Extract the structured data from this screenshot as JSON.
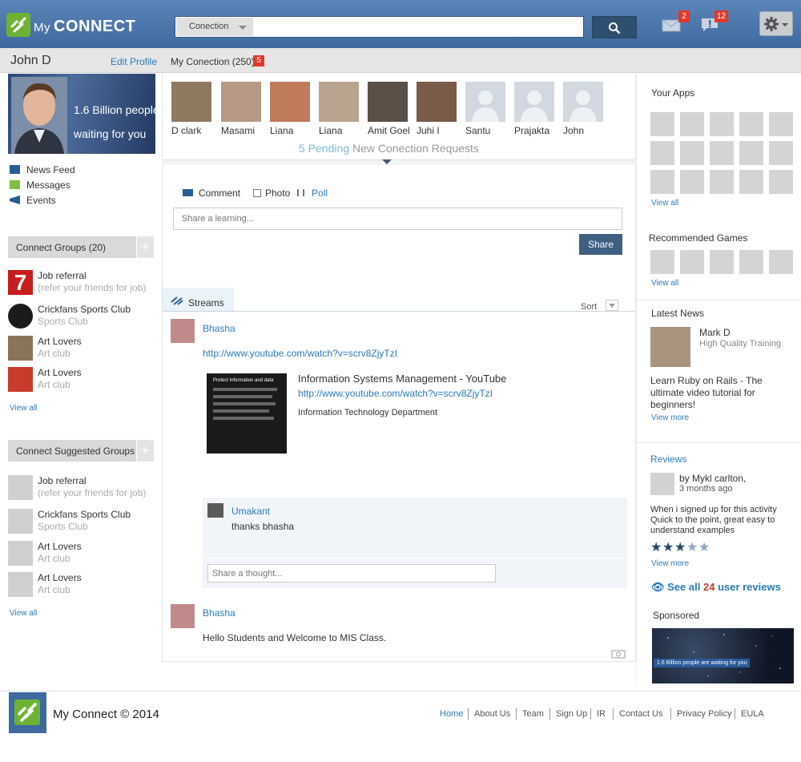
{
  "header": {
    "logo_my": "My",
    "logo_connect": "CONNECT",
    "search_select": "Conection",
    "search_placeholder": "",
    "mail_count": "2",
    "alerts_count": "12"
  },
  "subbar": {
    "user_name": "John D",
    "edit_profile": "Edit Profile",
    "my_connection": "My Conection (250)",
    "connection_badge": "5"
  },
  "left": {
    "banner_line1": "1.6 Billion people",
    "banner_line2": "waiting for you",
    "nav": [
      "News Feed",
      "Messages",
      "Events"
    ],
    "groups_heading": "Connect Groups  (20)",
    "groups": [
      {
        "title": "Job referral",
        "sub": "(refer your friends for job)"
      },
      {
        "title": "Crickfans Sports Club",
        "sub": "Sports Club"
      },
      {
        "title": "Art Lovers",
        "sub": "Art club"
      },
      {
        "title": "Art Lovers",
        "sub": "Art club"
      }
    ],
    "suggested_heading": "Connect Suggested Groups",
    "suggested": [
      {
        "title": "Job referral",
        "sub": "(refer your friends for job)"
      },
      {
        "title": "Crickfans Sports Club",
        "sub": "Sports Club"
      },
      {
        "title": "Art Lovers",
        "sub": "Art club"
      },
      {
        "title": "Art Lovers",
        "sub": "Art club"
      }
    ],
    "view_all": "View all",
    "groups_thumb_7": "7"
  },
  "connections": [
    {
      "name": "D clark"
    },
    {
      "name": "Masami"
    },
    {
      "name": "Liana"
    },
    {
      "name": "Liana"
    },
    {
      "name": "Amit Goel"
    },
    {
      "name": "Juhi I"
    },
    {
      "name": "Santu"
    },
    {
      "name": "Prajakta"
    },
    {
      "name": "John"
    }
  ],
  "pending": {
    "count": "5 Pending",
    "rest": "New Conection Requests"
  },
  "composer": {
    "tabs": [
      "Comment",
      "Photo",
      "Poll"
    ],
    "placeholder": "Share a learning...",
    "share": "Share"
  },
  "streams": {
    "tab": "Streams",
    "sort": "Sort"
  },
  "posts": [
    {
      "author": "Bhasha",
      "link": "http://www.youtube.com/watch?v=scrv8ZjyTzI",
      "preview_title": "Information Systems Management - YouTube",
      "preview_link": "http://www.youtube.com/watch?v=scrv8ZjyTzI",
      "preview_desc": "Information Technology Department",
      "thumb_title": "Protect information and data"
    },
    {
      "author": "Bhasha",
      "text": "Hello Students and Welcome to MIS Class."
    }
  ],
  "comment": {
    "author": "Umakant",
    "text": "thanks bhasha",
    "placeholder": "Share a thought..."
  },
  "right": {
    "your_apps": "Your Apps",
    "view_all": "View all",
    "games": "Recommended Games",
    "latest_news": "Latest News",
    "news_author": "Mark D",
    "news_role": "High Quality Training",
    "news_text": "Learn Ruby on Rails - The ultimate video tutorial for beginners!",
    "view_more": "View more",
    "reviews": "Reviews",
    "review_by": "by Mykl carlton,",
    "review_time": "3 months ago",
    "review_text": "When i signed up for this activity Quick to the point, great easy to understand examples",
    "rating": 3,
    "rating_max": 5,
    "see_all_pre": "See all",
    "see_all_count": "24",
    "see_all_post": "user reviews",
    "sponsored": "Sponsored",
    "sponsored_caption": "1.6 Billion people are waiting for you"
  },
  "footer": {
    "brand": "My Connect © 2014",
    "links": [
      "Home",
      "About Us",
      "Team",
      "Sign Up",
      "IR",
      "Contact Us",
      "Privacy Policy",
      "EULA"
    ]
  },
  "colors": {
    "accent": "#2a7ab8",
    "header": "#3e6a9f",
    "badge": "#e2382b",
    "brand_green": "#6fb233"
  }
}
